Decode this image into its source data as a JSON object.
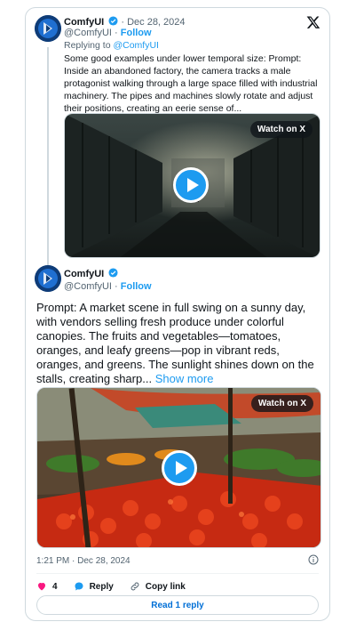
{
  "colors": {
    "accent": "#1d9bf0",
    "text": "#0f1419",
    "muted": "#536471",
    "border": "#cfd9de",
    "like": "#f91880"
  },
  "reply_tweet": {
    "display_name": "ComfyUI",
    "date": "· Dec 28, 2024",
    "handle": "@ComfyUI",
    "follow": "Follow",
    "replying_prefix": "Replying to ",
    "replying_to": "@ComfyUI",
    "text": "Some good examples under lower temporal size: Prompt: Inside an abandoned factory, the camera tracks a male protagonist walking through a large space filled with industrial machinery. The pipes and machines slowly rotate and adjust their positions, creating an eerie sense of...",
    "media_label": "Watch on X"
  },
  "main_tweet": {
    "display_name": "ComfyUI",
    "handle": "@ComfyUI",
    "follow": "Follow",
    "text": "Prompt: A market scene in full swing on a sunny day, with vendors selling fresh produce under colorful canopies. The fruits and vegetables—tomatoes, oranges, and leafy greens—pop in vibrant reds, oranges, and greens. The sunlight shines down on the stalls, creating sharp...",
    "show_more": "Show more",
    "media_label": "Watch on X",
    "timestamp": "1:21 PM · Dec 28, 2024"
  },
  "actions": {
    "likes": "4",
    "reply": "Reply",
    "copy_link": "Copy link"
  },
  "read_replies": "Read 1 reply",
  "icons": [
    "x-logo-icon",
    "verified-badge-icon",
    "play-icon",
    "info-icon",
    "heart-icon",
    "reply-icon",
    "link-icon"
  ]
}
